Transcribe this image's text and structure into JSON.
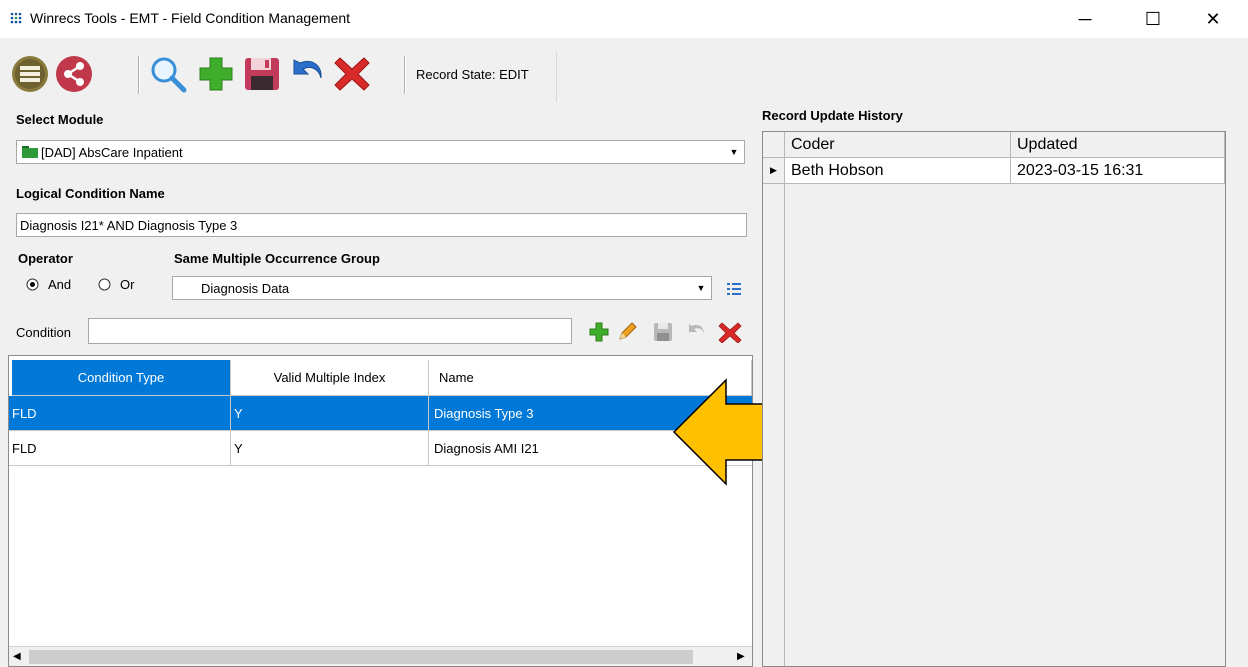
{
  "window": {
    "title": "Winrecs Tools - EMT - Field Condition Management",
    "minimize_glyph": "─",
    "maximize_glyph": "☐",
    "close_glyph": "✕"
  },
  "toolbar": {
    "icons": [
      "list-icon",
      "share-icon",
      "search-icon",
      "add-icon",
      "save-icon",
      "undo-icon",
      "delete-icon"
    ],
    "record_state": "Record State: EDIT"
  },
  "module": {
    "label": "Select Module",
    "value": "[DAD] AbsCare Inpatient"
  },
  "logical_condition": {
    "label": "Logical Condition Name",
    "value": "Diagnosis I21* AND Diagnosis Type 3"
  },
  "operator": {
    "label": "Operator",
    "options": [
      "And",
      "Or"
    ],
    "selected": "And"
  },
  "occurrence_group": {
    "label": "Same Multiple Occurrence Group",
    "value": "Diagnosis Data"
  },
  "condition": {
    "label": "Condition",
    "value": ""
  },
  "grid": {
    "columns": [
      "Condition Type",
      "Valid Multiple Index",
      "Name"
    ],
    "rows": [
      [
        "FLD",
        "Y",
        "Diagnosis Type 3"
      ],
      [
        "FLD",
        "Y",
        "Diagnosis AMI I21"
      ]
    ],
    "selected_row": 0
  },
  "history": {
    "label": "Record Update History",
    "columns": [
      "Coder",
      "Updated"
    ],
    "rows": [
      [
        "Beth Hobson",
        "2023-03-15 16:31"
      ]
    ]
  },
  "colors": {
    "selection": "#0078d7",
    "arrow": "#ffc000"
  }
}
